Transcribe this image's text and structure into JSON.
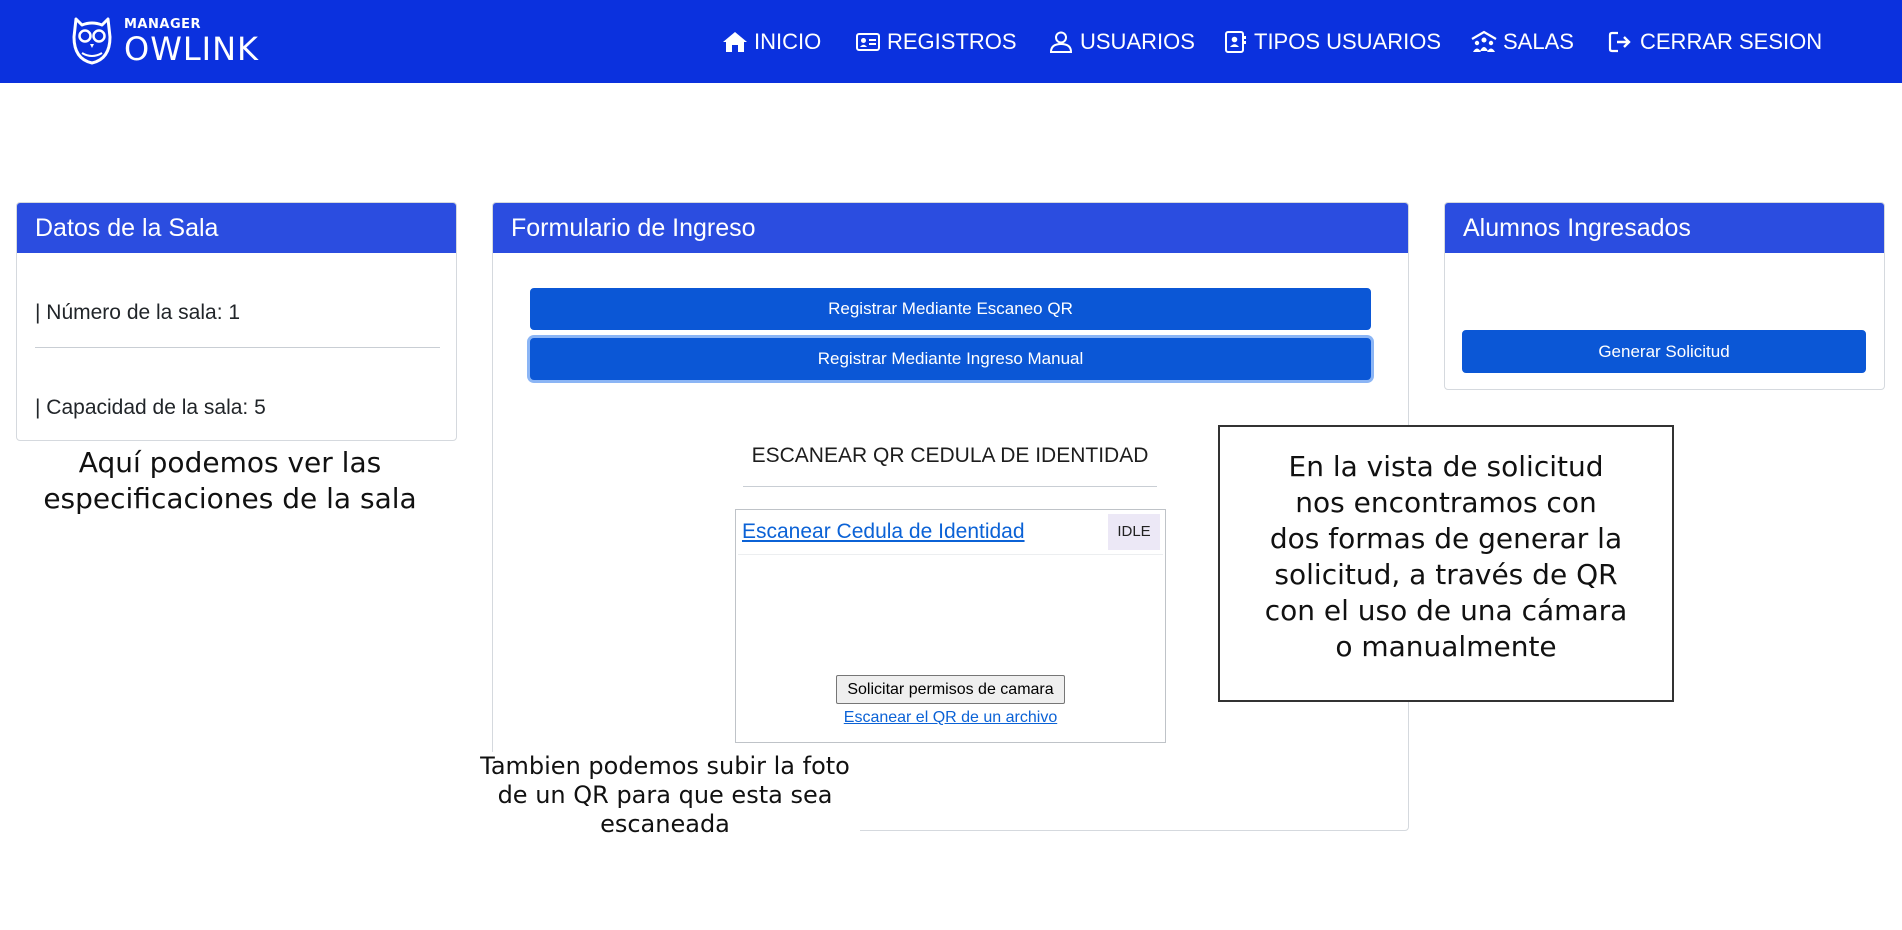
{
  "brand": {
    "small": "MANAGER",
    "big": "OWLINK"
  },
  "nav": {
    "items": [
      {
        "label": "INICIO",
        "icon": "home-icon"
      },
      {
        "label": "REGISTROS",
        "icon": "id-card-icon"
      },
      {
        "label": "USUARIOS",
        "icon": "user-icon"
      },
      {
        "label": "TIPOS USUARIOS",
        "icon": "contact-book-icon"
      },
      {
        "label": "SALAS",
        "icon": "people-roof-icon"
      },
      {
        "label": "CERRAR SESION",
        "icon": "sign-out-icon"
      }
    ]
  },
  "sala": {
    "title": "Datos de la Sala",
    "numero": "| Número de la sala: 1",
    "capacidad": "| Capacidad de la sala: 5"
  },
  "formulario": {
    "title": "Formulario de Ingreso",
    "btn_qr": "Registrar Mediante Escaneo QR",
    "btn_manual": "Registrar Mediante Ingreso Manual",
    "scan_title": "ESCANEAR QR CEDULA DE IDENTIDAD",
    "scan_link": "Escanear Cedula de Identidad",
    "status": "IDLE",
    "cam_button": "Solicitar permisos de camara",
    "file_link": "Escanear el QR de un archivo"
  },
  "alumnos": {
    "title": "Alumnos Ingresados",
    "btn_generar": "Generar Solicitud"
  },
  "annotations": {
    "sala": [
      "Aquí podemos ver las",
      "especificaciones de la sala"
    ],
    "foto": [
      "Tambien podemos subir la foto",
      "de un QR para que esta sea",
      "escaneada"
    ],
    "solicitud": [
      "En la vista de solicitud",
      "nos encontramos con",
      "dos formas de generar la",
      "solicitud, a través de QR",
      "con el uso de una cámara",
      "o manualmente"
    ]
  },
  "colors": {
    "navbar": "#0b31de",
    "card_header": "#2b4de0",
    "button": "#0b57d6",
    "link": "#0b62d6"
  }
}
